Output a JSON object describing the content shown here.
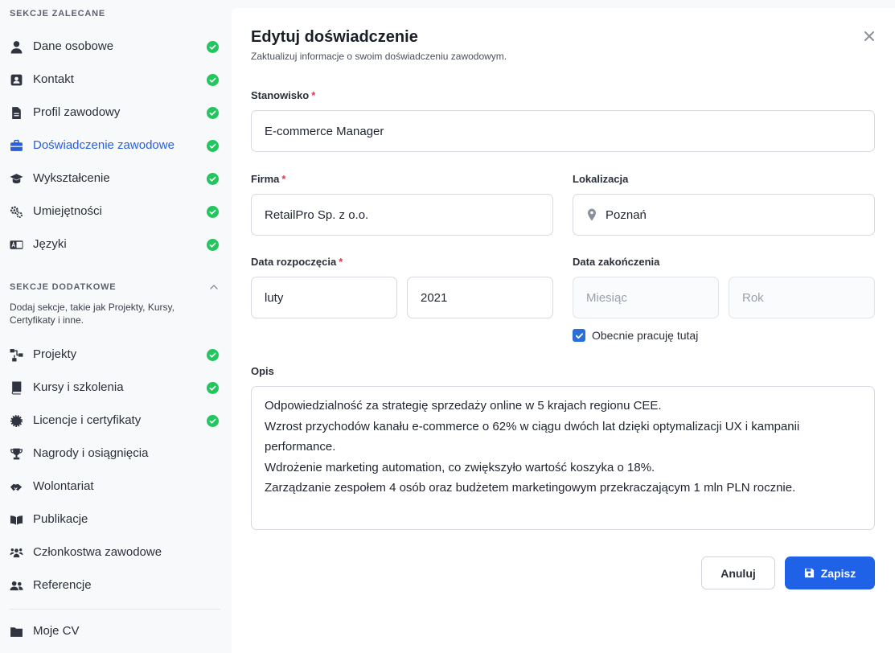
{
  "sidebar": {
    "recommended_heading": "SEKCJE ZALECANE",
    "recommended": [
      {
        "label": "Dane osobowe",
        "icon": "user-icon",
        "done": true
      },
      {
        "label": "Kontakt",
        "icon": "contact-card-icon",
        "done": true
      },
      {
        "label": "Profil zawodowy",
        "icon": "document-icon",
        "done": true
      },
      {
        "label": "Doświadczenie zawodowe",
        "icon": "briefcase-icon",
        "done": true,
        "active": true
      },
      {
        "label": "Wykształcenie",
        "icon": "graduation-cap-icon",
        "done": true
      },
      {
        "label": "Umiejętności",
        "icon": "gears-icon",
        "done": true
      },
      {
        "label": "Języki",
        "icon": "language-icon",
        "done": true
      }
    ],
    "additional_heading": "SEKCJE DODATKOWE",
    "additional_desc": "Dodaj sekcje, takie jak Projekty, Kursy, Certyfikaty i inne.",
    "additional": [
      {
        "label": "Projekty",
        "icon": "project-diagram-icon",
        "done": true
      },
      {
        "label": "Kursy i szkolenia",
        "icon": "book-icon",
        "done": true
      },
      {
        "label": "Licencje i certyfikaty",
        "icon": "certificate-icon",
        "done": true
      },
      {
        "label": "Nagrody i osiągnięcia",
        "icon": "trophy-icon",
        "done": false
      },
      {
        "label": "Wolontariat",
        "icon": "handshake-icon",
        "done": false
      },
      {
        "label": "Publikacje",
        "icon": "open-book-icon",
        "done": false
      },
      {
        "label": "Członkostwa zawodowe",
        "icon": "users-group-icon",
        "done": false
      },
      {
        "label": "Referencje",
        "icon": "user-friends-icon",
        "done": false
      }
    ],
    "my_cv": {
      "label": "Moje CV",
      "icon": "folder-icon"
    }
  },
  "modal": {
    "title": "Edytuj doświadczenie",
    "subtitle": "Zaktualizuj informacje o swoim doświadczeniu zawodowym.",
    "position_label": "Stanowisko",
    "position_value": "E-commerce Manager",
    "company_label": "Firma",
    "company_value": "RetailPro Sp. z o.o.",
    "location_label": "Lokalizacja",
    "location_value": "Poznań",
    "start_label": "Data rozpoczęcia",
    "start_month": "luty",
    "start_year": "2021",
    "end_label": "Data zakończenia",
    "end_month_placeholder": "Miesiąc",
    "end_year_placeholder": "Rok",
    "current_label": "Obecnie pracuję tutaj",
    "current_checked": true,
    "required_mark": "*",
    "description_label": "Opis",
    "description_lines": [
      "Odpowiedzialność za strategię sprzedaży online w 5 krajach regionu CEE.",
      "Wzrost przychodów kanału e-commerce o 62% w ciągu dwóch lat dzięki optymalizacji UX i kampanii performance.",
      "Wdrożenie marketing automation, co zwiększyło wartość koszyka o 18%.",
      "Zarządzanie zespołem 4 osób oraz budżetem marketingowym przekraczającym 1 mln PLN rocznie."
    ],
    "cancel_label": "Anuluj",
    "save_label": "Zapisz"
  },
  "colors": {
    "accent": "#1f62e8",
    "success": "#22c55e",
    "required": "#e0344b",
    "active_nav": "#2a5fd8"
  }
}
